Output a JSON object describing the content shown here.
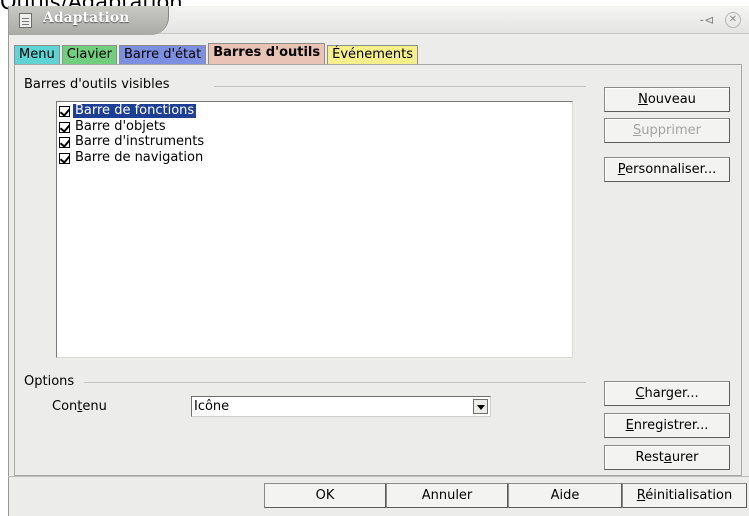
{
  "page_caption": "Outils/Adaptation...",
  "window": {
    "title": "Adaptation",
    "icon": "document-icon",
    "controls": {
      "minimize_icon": "pin-icon",
      "close_icon": "close-icon"
    }
  },
  "tabs": [
    {
      "label": "Menu",
      "color": "#5fd4d4",
      "active": false
    },
    {
      "label": "Clavier",
      "color": "#6fcf7c",
      "active": false
    },
    {
      "label": "Barre d'état",
      "color": "#7c8fe0",
      "active": false
    },
    {
      "label": "Barres d'outils",
      "color": "#e9c3b4",
      "active": true
    },
    {
      "label": "Événements",
      "color": "#f6f08a",
      "active": false
    }
  ],
  "toolbars_group": {
    "label": "Barres d'outils visibles",
    "items": [
      {
        "label": "Barre de fonctions",
        "checked": true,
        "selected": true
      },
      {
        "label": "Barre d'objets",
        "checked": true,
        "selected": false
      },
      {
        "label": "Barre d'instruments",
        "checked": true,
        "selected": false
      },
      {
        "label": "Barre de navigation",
        "checked": true,
        "selected": false
      }
    ]
  },
  "right_buttons": {
    "new": {
      "label": "Nouveau",
      "mnemonic": "N",
      "rest": "ouveau",
      "enabled": true
    },
    "delete": {
      "label": "Supprimer",
      "mnemonic": "S",
      "rest": "upprimer",
      "enabled": false
    },
    "customize": {
      "label": "Personnaliser...",
      "mnemonic": "P",
      "rest": "ersonnaliser...",
      "enabled": true
    },
    "load": {
      "label": "Charger...",
      "mnemonic": "C",
      "rest": "harger...",
      "enabled": true
    },
    "save": {
      "label": "Enregistrer...",
      "mnemonic": "E",
      "rest": "nregistrer...",
      "enabled": true
    },
    "reset": {
      "label": "Restaurer",
      "pre": "Rest",
      "mnemonic": "a",
      "rest": "urer",
      "enabled": true
    }
  },
  "options_group": {
    "label": "Options",
    "content_label_pre": "Con",
    "content_label_mnemonic": "t",
    "content_label_rest": "enu",
    "content_value": "Icône"
  },
  "footer": {
    "ok": "OK",
    "cancel": "Annuler",
    "help": "Aide",
    "reset_mnemonic": "R",
    "reset_rest": "éinitialisation"
  }
}
